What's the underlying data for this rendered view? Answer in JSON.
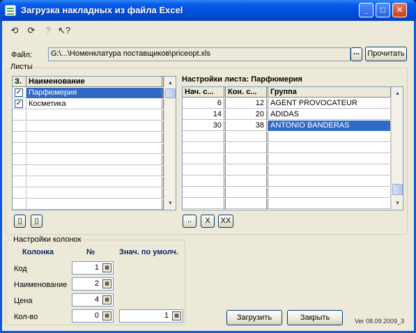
{
  "window": {
    "title": "Загрузка накладных из файла Excel",
    "controls": {
      "minimize": "_",
      "maximize": "□",
      "close": "✕"
    }
  },
  "toolbar": {
    "icons": [
      "load-icon",
      "reload-icon",
      "help-icon",
      "cursor-help-icon"
    ],
    "glyphs": {
      "load": "⟲",
      "reload": "⟳",
      "help": "?",
      "whatsthis": "↖?"
    }
  },
  "file": {
    "label": "Файл:",
    "value": "G:\\...\\Номенклатура поставщиков\\priceopt.xls",
    "browse_label": "...",
    "read_label": "Прочитать"
  },
  "sheets": {
    "group_title": "Листы",
    "headers": [
      "З.",
      "Наименование"
    ],
    "rows": [
      {
        "checked": true,
        "name": "Парфюмерия",
        "selected": true
      },
      {
        "checked": true,
        "name": "Косметика",
        "selected": false
      }
    ],
    "buttons": {
      "select_all": "▯",
      "deselect_all": "▯"
    }
  },
  "sheet_settings": {
    "title": "Настройки листа:",
    "sheet_name": "Парфюмерия",
    "headers": [
      "Нач. с...",
      "Кон. с...",
      "Группа"
    ],
    "rows": [
      {
        "start": "6",
        "end": "12",
        "group": "AGENT PROVOCATEUR",
        "selected": false
      },
      {
        "start": "14",
        "end": "20",
        "group": "ADIDAS",
        "selected": false
      },
      {
        "start": "30",
        "end": "38",
        "group": "ANTONIO BANDERAS",
        "selected": true
      }
    ],
    "buttons": {
      "add": "..",
      "delete": "X",
      "delete_all": "XX"
    }
  },
  "column_settings": {
    "group_title": "Настройки колонок",
    "headers": {
      "column": "Колонка",
      "number": "№",
      "default": "Знач. по умолч."
    },
    "rows": [
      {
        "name": "Код",
        "number": "1"
      },
      {
        "name": "Наименование",
        "number": "2"
      },
      {
        "name": "Цена",
        "number": "4"
      },
      {
        "name": "Кол-во",
        "number": "0",
        "default": "1"
      }
    ]
  },
  "actions": {
    "load_label": "Загрузить",
    "close_label": "Закрыть"
  },
  "version": "Ver 08.09.2009_3",
  "colors": {
    "selection": "#316ac5",
    "face": "#ece9d8",
    "titlebar": "#0050e0"
  }
}
